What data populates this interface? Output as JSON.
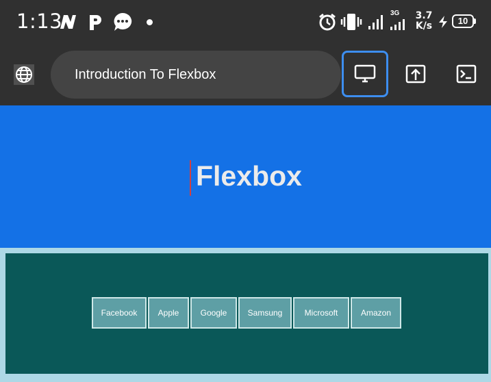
{
  "status_bar": {
    "time": "1:13",
    "network_type": "3G",
    "speed_value": "3.7",
    "speed_unit": "K/s",
    "battery": "10"
  },
  "toolbar": {
    "page_title": "Introduction To Flexbox"
  },
  "page": {
    "heading": "Flexbox",
    "nav_items": [
      "Facebook",
      "Apple",
      "Google",
      "Samsung",
      "Microsoft",
      "Amazon"
    ]
  },
  "colors": {
    "status_bg": "#303030",
    "hero_bg": "#1471e6",
    "flex_bg": "#0a5858",
    "item_bg": "#5e9fa5",
    "page_bg": "#add8e6",
    "active_outline": "#3d8ef0"
  }
}
